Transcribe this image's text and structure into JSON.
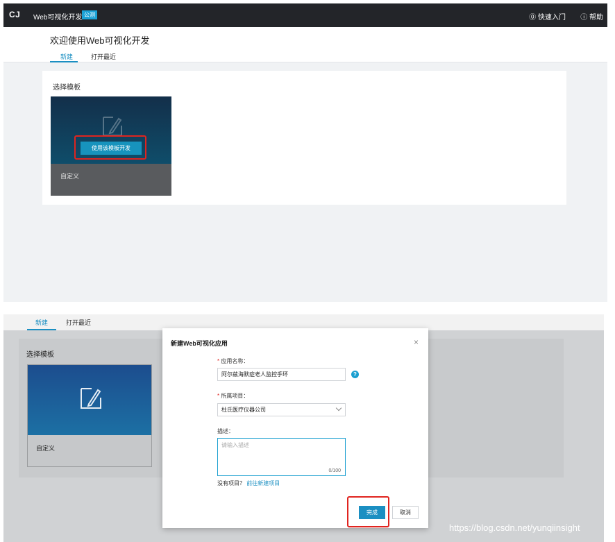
{
  "top": {
    "logo": "C J",
    "app_title": "Web可视化开发",
    "beta_badge": "公测",
    "quickstart": "⓪ 快速入门",
    "help": "ⓘ 帮助",
    "welcome": "欢迎使用Web可视化开发",
    "tabs": [
      {
        "label": "新建"
      },
      {
        "label": "打开最近"
      }
    ],
    "panel_title": "选择模板",
    "template": {
      "button": "使用该模板开发",
      "label": "自定义"
    }
  },
  "bottom": {
    "tabs": [
      {
        "label": "新建"
      },
      {
        "label": "打开最近"
      }
    ],
    "panel_title": "选择模板",
    "template": {
      "label": "自定义"
    },
    "modal": {
      "title": "新建Web可视化应用",
      "close": "×",
      "name_label": "应用名称：",
      "name_value": "阿尔兹海默症老人监控手环",
      "project_label": "所属项目：",
      "project_value": "杜氏医疗仪器公司",
      "desc_label": "描述：",
      "desc_placeholder": "请输入描述",
      "desc_counter": "0/100",
      "no_project": "没有项目？",
      "new_project_link": "前往新建项目",
      "done": "完成",
      "cancel": "取消",
      "required_mark": "*",
      "help_icon": "?"
    },
    "watermark": "https://blog.csdn.net/yunqiinsight"
  },
  "colors": {
    "accent": "#1b8fc2",
    "highlight": "#e0241f",
    "topbar": "#232529"
  },
  "icons": [
    "logo-icon",
    "book-icon",
    "help-circle-icon",
    "edit-template-icon",
    "close-icon",
    "chevron-down-icon",
    "question-icon"
  ]
}
